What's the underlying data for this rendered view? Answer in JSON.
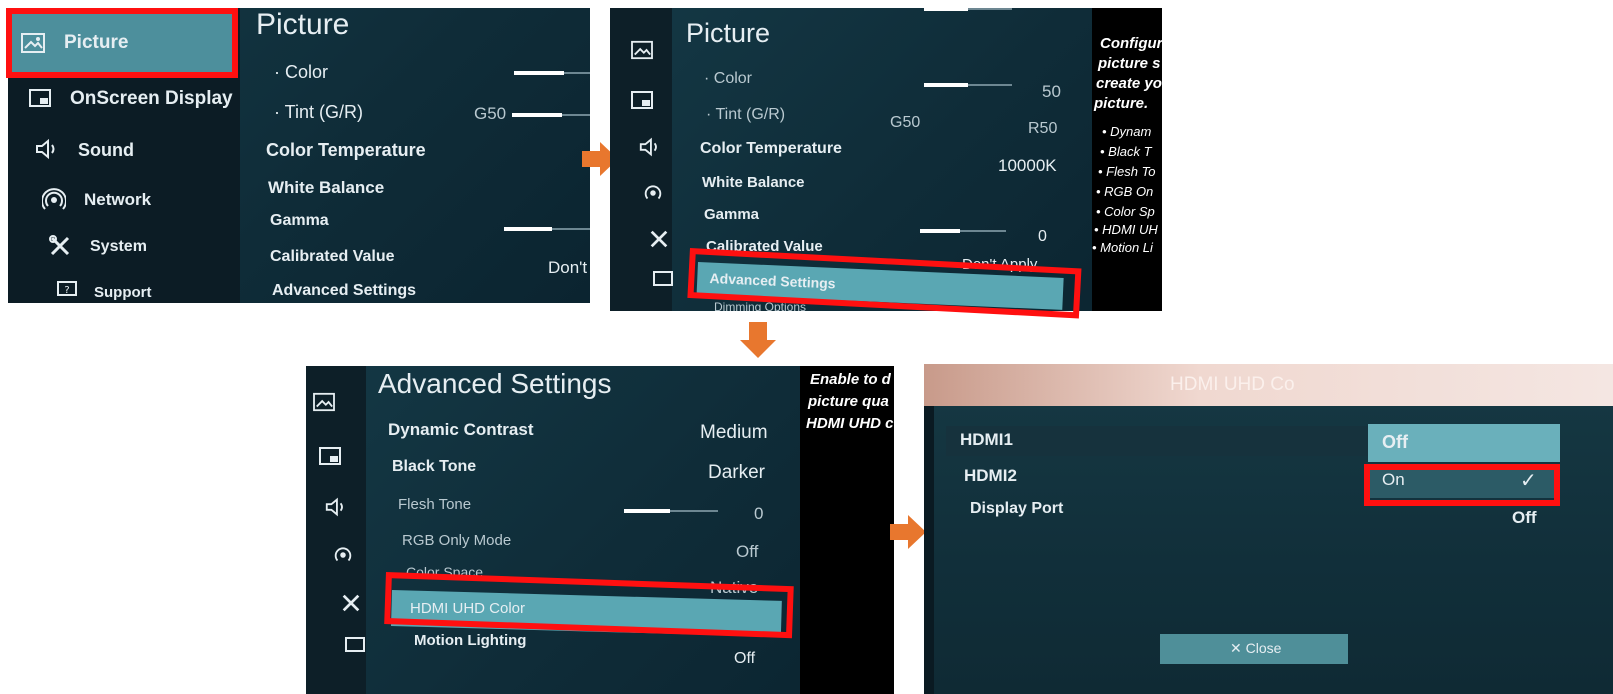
{
  "panel1": {
    "sidebar": [
      {
        "label": "Picture",
        "icon": "picture-icon"
      },
      {
        "label": "OnScreen Display",
        "icon": "onscreen-display-icon"
      },
      {
        "label": "Sound",
        "icon": "sound-icon"
      },
      {
        "label": "Network",
        "icon": "network-icon"
      },
      {
        "label": "System",
        "icon": "system-icon"
      },
      {
        "label": "Support",
        "icon": "support-icon"
      }
    ],
    "title": "Picture",
    "items": {
      "color": "· Color",
      "tint": "· Tint (G/R)",
      "tint_left": "G50",
      "color_temp": "Color Temperature",
      "white_balance": "White Balance",
      "gamma": "Gamma",
      "calibrated": "Calibrated Value",
      "calibrated_value": "Don't",
      "advanced": "Advanced Settings"
    }
  },
  "panel2": {
    "title": "Picture",
    "items": {
      "color": "· Color",
      "color_value": "50",
      "tint": "· Tint (G/R)",
      "tint_left": "G50",
      "tint_right": "R50",
      "color_temp": "Color Temperature",
      "color_temp_value": "10000K",
      "white_balance": "White Balance",
      "gamma": "Gamma",
      "gamma_value": "0",
      "calibrated": "Calibrated Value",
      "calibrated_value": "Don't Apply",
      "advanced": "Advanced Settings",
      "next": "Dimming Options"
    },
    "description": [
      "Configur",
      "picture s",
      "create yo",
      "picture."
    ],
    "bullets": [
      "• Dynam",
      "• Black T",
      "• Flesh To",
      "• RGB On",
      "• Color Sp",
      "• HDMI UH",
      "• Motion Li"
    ]
  },
  "panel3": {
    "title": "Advanced Settings",
    "items": [
      {
        "label": "Dynamic Contrast",
        "value": "Medium"
      },
      {
        "label": "Black Tone",
        "value": "Darker"
      },
      {
        "label": "Flesh Tone",
        "value": "0"
      },
      {
        "label": "RGB Only Mode",
        "value": "Off"
      },
      {
        "label": "Color Space",
        "value": "Native"
      },
      {
        "label": "HDMI UHD Color",
        "value": ""
      },
      {
        "label": "Motion Lighting",
        "value": "Off"
      }
    ],
    "description": [
      "Enable to d",
      "picture qua",
      "HDMI UHD c"
    ]
  },
  "panel4": {
    "title": "HDMI UHD Co",
    "rows": [
      {
        "label": "HDMI1"
      },
      {
        "label": "HDMI2"
      },
      {
        "label": "Display Port",
        "value": "Off"
      }
    ],
    "options": [
      "Off",
      "On"
    ],
    "check": "✓",
    "close": "✕ Close"
  },
  "colors": {
    "highlight": "#ff1010",
    "arrow": "#e8772e",
    "selection": "#5aa7b3"
  }
}
